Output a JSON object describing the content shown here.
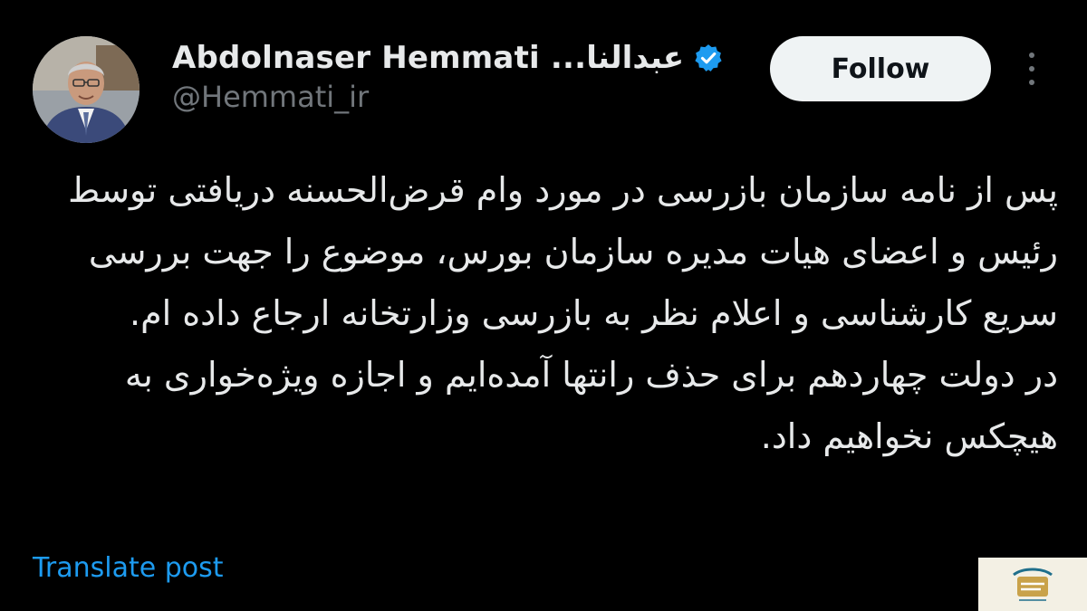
{
  "author": {
    "display_name": "Abdolnaser Hemmati ...عبدالنا",
    "handle": "@Hemmati_ir",
    "verified_icon": "verified-badge-icon",
    "verified_color": "#1d9bf0"
  },
  "actions": {
    "follow_label": "Follow",
    "more_icon": "more-options-icon"
  },
  "tweet": {
    "paragraph_1": "پس از نامه سازمان بازرسی در مورد وام قرض‌الحسنه دریافتی توسط رئیس و اعضای هیات مدیره سازمان بورس، موضوع را جهت بررسی سریع کارشناسی و اعلام نظر به بازرسی وزارتخانه ارجاع داده ام.",
    "paragraph_2": "در دولت چهاردهم برای حذف رانتها آمده‌ایم و اجازه ویژه‌خواری به هیچکس نخواهیم داد."
  },
  "footer": {
    "translate_label": "Translate post"
  },
  "colors": {
    "background": "#000000",
    "text_primary": "#e7e9ea",
    "text_secondary": "#71767b",
    "link": "#1d9bf0",
    "button_bg": "#eff3f4"
  }
}
